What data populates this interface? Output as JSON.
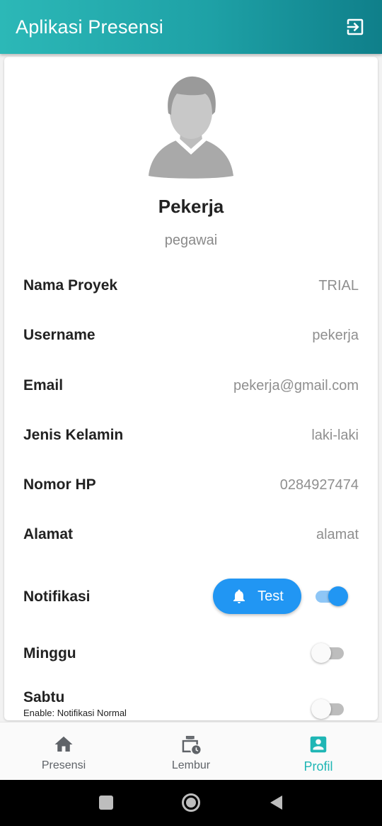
{
  "app": {
    "title": "Aplikasi Presensi"
  },
  "profile": {
    "name": "Pekerja",
    "role": "pegawai"
  },
  "info": [
    {
      "label": "Nama Proyek",
      "value": "TRIAL"
    },
    {
      "label": "Username",
      "value": "pekerja"
    },
    {
      "label": "Email",
      "value": "pekerja@gmail.com"
    },
    {
      "label": "Jenis Kelamin",
      "value": "laki-laki"
    },
    {
      "label": "Nomor HP",
      "value": "0284927474"
    },
    {
      "label": "Alamat",
      "value": "alamat"
    }
  ],
  "notifications": {
    "label": "Notifikasi",
    "test_button": "Test",
    "enabled": true,
    "minggu": {
      "label": "Minggu",
      "enabled": false
    },
    "sabtu": {
      "label": "Sabtu",
      "sublabel": "Enable: Notifikasi Normal",
      "enabled": false
    }
  },
  "bottom_nav": [
    {
      "label": "Presensi",
      "icon": "home-icon",
      "active": false
    },
    {
      "label": "Lembur",
      "icon": "briefcase-clock-icon",
      "active": false
    },
    {
      "label": "Profil",
      "icon": "account-box-icon",
      "active": true
    }
  ],
  "colors": {
    "primary": "#1fb6b5",
    "accent": "#2196f3"
  }
}
